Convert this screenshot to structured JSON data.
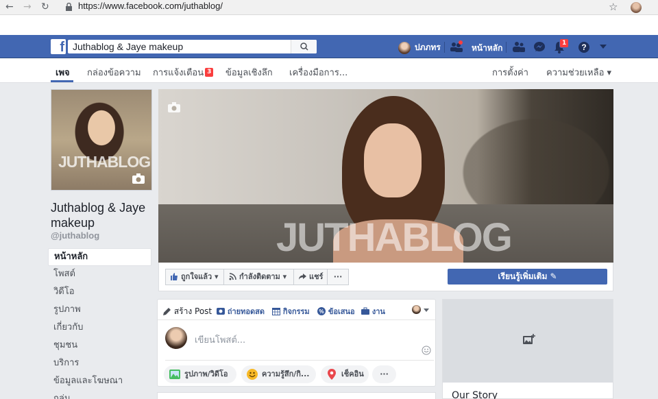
{
  "browser": {
    "url": "https://www.facebook.com/juthablog/"
  },
  "topbar": {
    "search_value": "Juthablog & Jaye makeup",
    "user_name": "ปภภทร",
    "home_label": "หน้าหลัก",
    "notifications_count": "1",
    "brand_color": "#4267b2"
  },
  "tabs": {
    "page": "เพจ",
    "inbox": "กล่องข้อความ",
    "notifications": "การแจ้งเตือน",
    "notifications_badge": "3",
    "insights": "ข้อมูลเชิงลึก",
    "tools": "เครื่องมือการ...",
    "settings": "การตั้งค่า",
    "help": "ความช่วยเหลือ ▾"
  },
  "profile": {
    "watermark": "JUTHABLOG",
    "name": "Juthablog & Jaye makeup",
    "handle": "@juthablog"
  },
  "leftnav": [
    "หน้าหลัก",
    "โพสต์",
    "วิดีโอ",
    "รูปภาพ",
    "เกี่ยวกับ",
    "ชุมชน",
    "บริการ",
    "ข้อมูลและโฆษณา",
    "กลุ่ม"
  ],
  "cover": {
    "watermark": "JUTHABLOG"
  },
  "actions": {
    "like": "ถูกใจแล้ว ▾",
    "follow": "กำลังติดตาม ▾",
    "share": "แชร์",
    "more": "···",
    "learn_more": "เรียนรู้เพิ่มเติม ✎"
  },
  "composer": {
    "tabs": [
      "สร้าง Post",
      "ถ่ายทอดสด",
      "กิจกรรม",
      "ข้อเสนอ",
      "งาน"
    ],
    "placeholder": "เขียนโพสต์...",
    "buttons": [
      "รูปภาพ/วิดีโอ",
      "ความรู้สึก/กิ...",
      "เช็คอิน",
      "···"
    ]
  },
  "story": {
    "title": "Our Story"
  }
}
